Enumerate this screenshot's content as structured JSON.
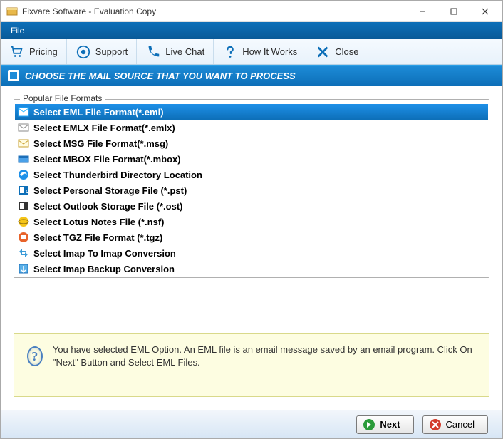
{
  "window": {
    "title": "Fixvare Software - Evaluation Copy"
  },
  "menubar": {
    "file": "File"
  },
  "toolbar": {
    "pricing": "Pricing",
    "support": "Support",
    "live_chat": "Live Chat",
    "how_it_works": "How It Works",
    "close": "Close"
  },
  "section": {
    "title": "CHOOSE THE MAIL SOURCE THAT YOU WANT TO PROCESS"
  },
  "groupbox": {
    "legend": "Popular File Formats"
  },
  "formats": [
    {
      "label": "Select EML File Format(*.eml)",
      "selected": true,
      "icon": "eml"
    },
    {
      "label": "Select EMLX File Format(*.emlx)",
      "selected": false,
      "icon": "emlx"
    },
    {
      "label": "Select MSG File Format(*.msg)",
      "selected": false,
      "icon": "msg"
    },
    {
      "label": "Select MBOX File Format(*.mbox)",
      "selected": false,
      "icon": "mbox"
    },
    {
      "label": "Select Thunderbird Directory Location",
      "selected": false,
      "icon": "thunderbird"
    },
    {
      "label": "Select Personal Storage File (*.pst)",
      "selected": false,
      "icon": "pst"
    },
    {
      "label": "Select Outlook Storage File (*.ost)",
      "selected": false,
      "icon": "ost"
    },
    {
      "label": "Select Lotus Notes File (*.nsf)",
      "selected": false,
      "icon": "nsf"
    },
    {
      "label": "Select TGZ File Format (*.tgz)",
      "selected": false,
      "icon": "tgz"
    },
    {
      "label": "Select Imap To Imap Conversion",
      "selected": false,
      "icon": "imap"
    },
    {
      "label": "Select Imap Backup Conversion",
      "selected": false,
      "icon": "imapbackup"
    }
  ],
  "info": {
    "text": "You have selected EML Option. An EML file is an email message saved by an email program. Click On \"Next\" Button and Select EML Files."
  },
  "buttons": {
    "next": "Next",
    "cancel": "Cancel"
  }
}
